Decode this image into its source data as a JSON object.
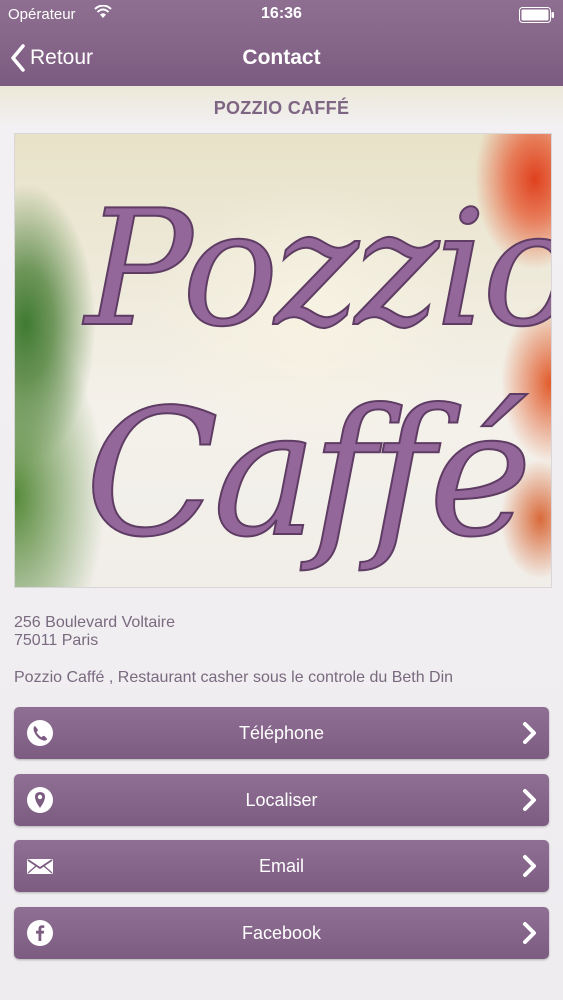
{
  "status_bar": {
    "carrier": "Opérateur",
    "time": "16:36"
  },
  "nav": {
    "back_label": "Retour",
    "title": "Contact"
  },
  "venue": {
    "title": "POZZIO CAFFÉ",
    "logo_line1": "Pozzio",
    "logo_line2": "Caffé",
    "address_line1": "256 Boulevard Voltaire",
    "address_line2": "75011 Paris",
    "description": "Pozzio Caffé , Restaurant casher sous le controle du Beth Din"
  },
  "actions": [
    {
      "label": "Téléphone",
      "icon": "phone-icon"
    },
    {
      "label": "Localiser",
      "icon": "location-pin-icon"
    },
    {
      "label": "Email",
      "icon": "envelope-icon"
    },
    {
      "label": "Facebook",
      "icon": "facebook-icon"
    }
  ],
  "colors": {
    "accent": "#7f5f84",
    "text": "#7a6a7f",
    "background": "#eeecef"
  }
}
